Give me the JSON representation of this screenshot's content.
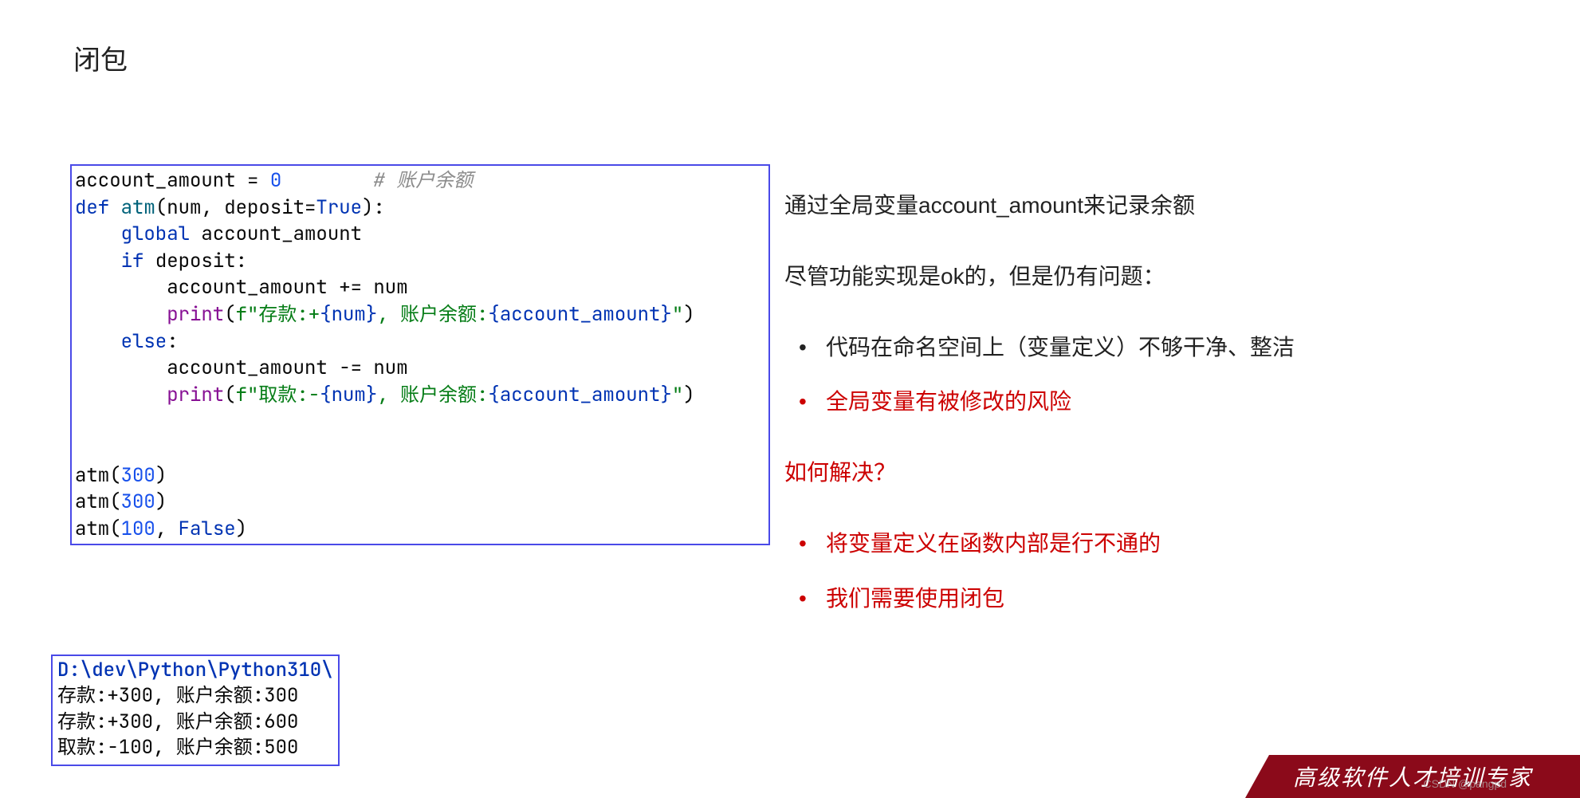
{
  "title": "闭包",
  "code": {
    "l1_a": "account_amount = ",
    "l1_num": "0",
    "l1_cmt": "# 账户余额",
    "l2_def": "def ",
    "l2_fn": "atm",
    "l2_open": "(num, deposit=",
    "l2_true": "True",
    "l2_close": "):",
    "l3_a": "    ",
    "l3_kw": "global ",
    "l3_b": "account_amount",
    "l4_a": "    ",
    "l4_kw": "if ",
    "l4_b": "deposit:",
    "l5": "        account_amount += num",
    "l6_a": "        ",
    "l6_print": "print",
    "l6_b": "(",
    "l6_f": "f\"存款:+",
    "l6_c": "{num}",
    "l6_d": ", 账户余额:",
    "l6_e": "{account_amount}",
    "l6_g": "\"",
    "l6_h": ")",
    "l7_a": "    ",
    "l7_kw": "else",
    "l7_b": ":",
    "l8": "        account_amount -= num",
    "l9_a": "        ",
    "l9_print": "print",
    "l9_b": "(",
    "l9_f": "f\"取款:-",
    "l9_c": "{num}",
    "l9_d": ", 账户余额:",
    "l9_e": "{account_amount}",
    "l9_g": "\"",
    "l9_h": ")",
    "blank": "",
    "c1_a": "atm(",
    "c1_n": "300",
    "c1_b": ")",
    "c2_a": "atm(",
    "c2_n": "300",
    "c2_b": ")",
    "c3_a": "atm(",
    "c3_n": "100",
    "c3_b": ", ",
    "c3_false": "False",
    "c3_c": ")"
  },
  "output": {
    "path": "D:\\dev\\Python\\Python310\\",
    "lines": [
      "存款:+300, 账户余额:300",
      "存款:+300, 账户余额:600",
      "取款:-100, 账户余额:500"
    ]
  },
  "right": {
    "p1": "通过全局变量account_amount来记录余额",
    "p2": "尽管功能实现是ok的，但是仍有问题：",
    "bullets1": [
      {
        "text": "代码在命名空间上（变量定义）不够干净、整洁",
        "red": false
      },
      {
        "text": "全局变量有被修改的风险",
        "red": true
      }
    ],
    "p3": "如何解决？",
    "bullets2": [
      {
        "text": "将变量定义在函数内部是行不通的",
        "red": true
      },
      {
        "text": "我们需要使用闭包",
        "red": true
      }
    ]
  },
  "footer": "高级软件人才培训专家",
  "watermark": "CSDN @pangpd"
}
